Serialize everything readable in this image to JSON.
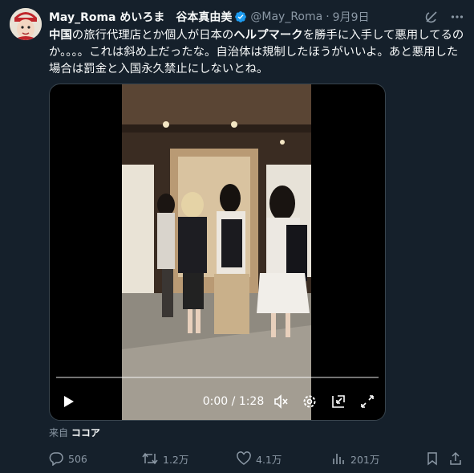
{
  "tweet": {
    "display_name": "May_Roma めいろま　谷本真由美",
    "handle": "@May_Roma",
    "separator": "·",
    "date": "9月9日",
    "text_parts": [
      "中国",
      "の旅行代理店とか個人が日本の",
      "ヘルプマーク",
      "を勝手に入手して悪用してるのか。。。。これは斜め上だったな。自治体は規制したほうがいいよ。あと悪用した場合は罰金と入国永久禁止にしないとね。"
    ],
    "source_prefix": "来自",
    "source_name": "ココア"
  },
  "video": {
    "current_time": "0:00",
    "time_separator": "/",
    "duration": "1:28",
    "progress": 0
  },
  "actions": {
    "replies": "506",
    "retweets": "1.2万",
    "likes": "4.1万",
    "views": "201万"
  },
  "colors": {
    "background": "#15202b",
    "text": "#f7f9f9",
    "muted": "#8b98a5",
    "verified": "#1d9bf0"
  },
  "icons": [
    "grok-icon",
    "more-icon",
    "verified-badge-icon",
    "play-icon",
    "mute-icon",
    "settings-icon",
    "pip-icon",
    "fullscreen-icon",
    "reply-icon",
    "retweet-icon",
    "like-icon",
    "views-icon",
    "bookmark-icon",
    "share-icon"
  ]
}
